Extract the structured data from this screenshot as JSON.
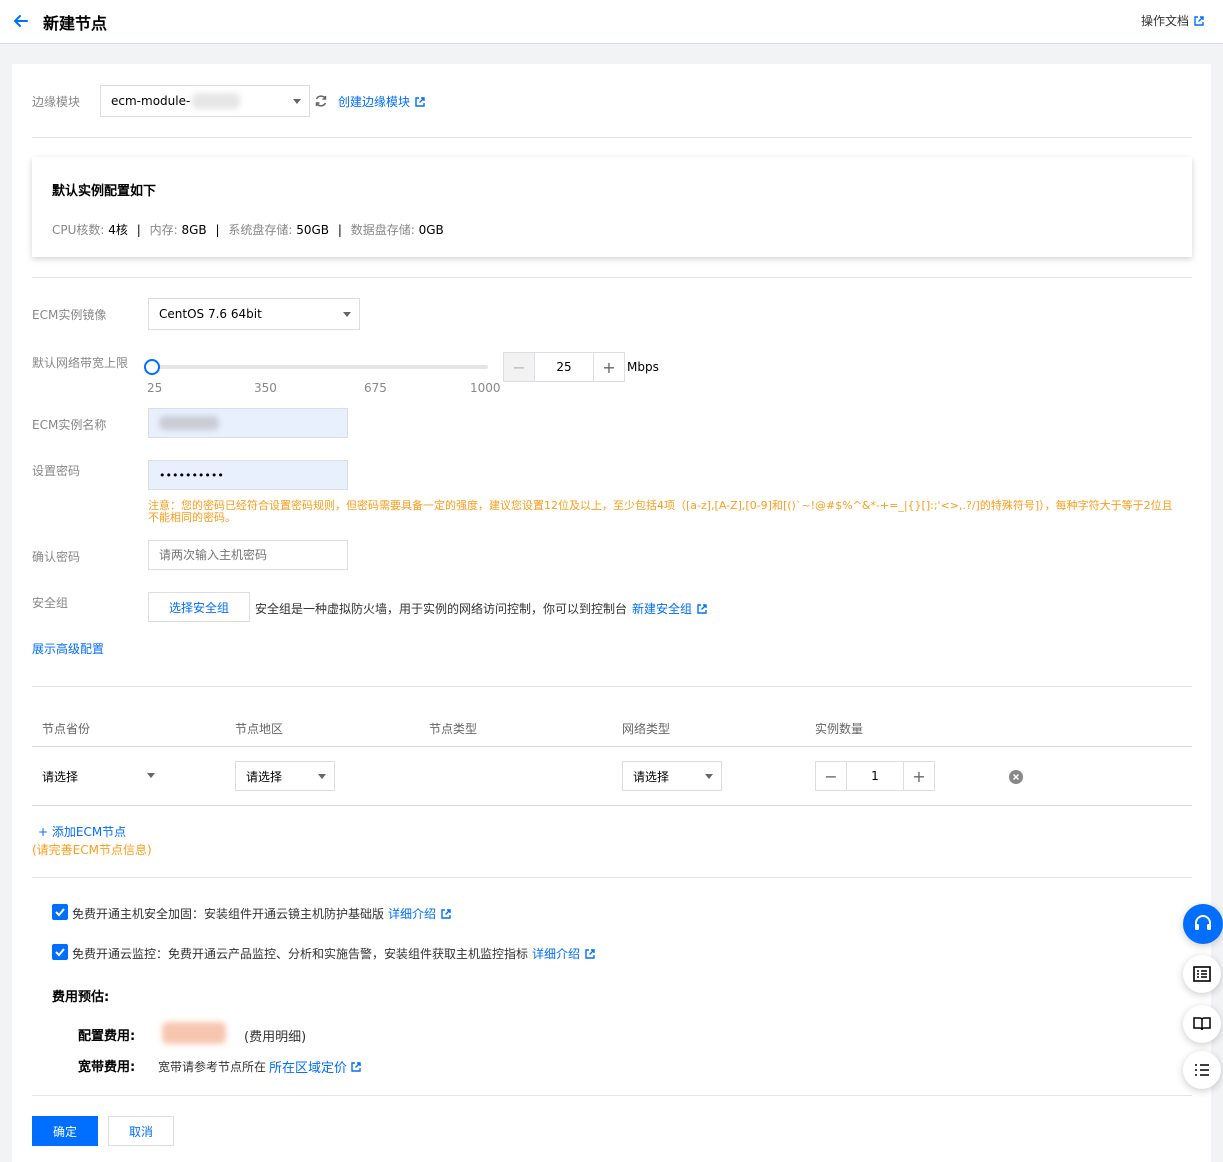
{
  "header": {
    "title": "新建节点",
    "doc_link": "操作文档"
  },
  "module": {
    "label": "边缘模块",
    "value": "ecm-module-",
    "create_link": "创建边缘模块"
  },
  "default_config": {
    "title": "默认实例配置如下",
    "cpu_label": "CPU核数: ",
    "cpu_value": "4核",
    "mem_label": "内存: ",
    "mem_value": "8GB",
    "sys_disk_label": "系统盘存储: ",
    "sys_disk_value": "50GB",
    "data_disk_label": "数据盘存储: ",
    "data_disk_value": "0GB",
    "separator": "|"
  },
  "image": {
    "label": "ECM实例镜像",
    "value": "CentOS 7.6 64bit"
  },
  "bandwidth": {
    "label": "默认网络带宽上限",
    "ticks": [
      "25",
      "350",
      "675",
      "1000"
    ],
    "min": 25,
    "max": 1000,
    "value": "25",
    "unit": "Mbps",
    "minus": "−",
    "plus": "+"
  },
  "instance_name": {
    "label": "ECM实例名称"
  },
  "password": {
    "label": "设置密码",
    "value": "••••••••••",
    "warning": "注意：您的密码已经符合设置密码规则，但密码需要具备一定的强度，建议您设置12位及以上，至少包括4项（[a-z],[A-Z],[0-9]和[()`~!@#$%^&*-+=_|{}[]:;'<>,.?/]的特殊符号]），每种字符大于等于2位且不能相同的密码。"
  },
  "confirm_password": {
    "label": "确认密码",
    "placeholder": "请两次输入主机密码"
  },
  "security_group": {
    "label": "安全组",
    "button": "选择安全组",
    "desc": "安全组是一种虚拟防火墙，用于实例的网络访问控制，你可以到控制台",
    "create_link": "新建安全组"
  },
  "advanced_link": "展示高级配置",
  "node_table": {
    "headers": [
      "节点省份",
      "节点地区",
      "节点类型",
      "网络类型",
      "实例数量"
    ],
    "row": {
      "province": "请选择",
      "region": "请选择",
      "network": "请选择",
      "count": "1",
      "minus": "−",
      "plus": "+"
    },
    "add_link": "+ 添加ECM节点",
    "add_hint": "(请完善ECM节点信息)"
  },
  "options": [
    {
      "text": "免费开通主机安全加固：安装组件开通云镜主机防护基础版",
      "link": "详细介绍"
    },
    {
      "text": "免费开通云监控：免费开通云产品监控、分析和实施告警，安装组件获取主机监控指标",
      "link": "详细介绍"
    }
  ],
  "cost": {
    "title": "费用预估:",
    "config_label": "配置费用:",
    "config_detail": "(费用明细)",
    "bandwidth_label": "宽带费用:",
    "bandwidth_text": "宽带请参考节点所在",
    "bandwidth_link": "所在区域定价"
  },
  "actions": {
    "confirm": "确定",
    "cancel": "取消"
  },
  "colors": {
    "primary": "#006eff",
    "warning": "#ff9c19",
    "cost_blur": "#f7c6b0"
  }
}
